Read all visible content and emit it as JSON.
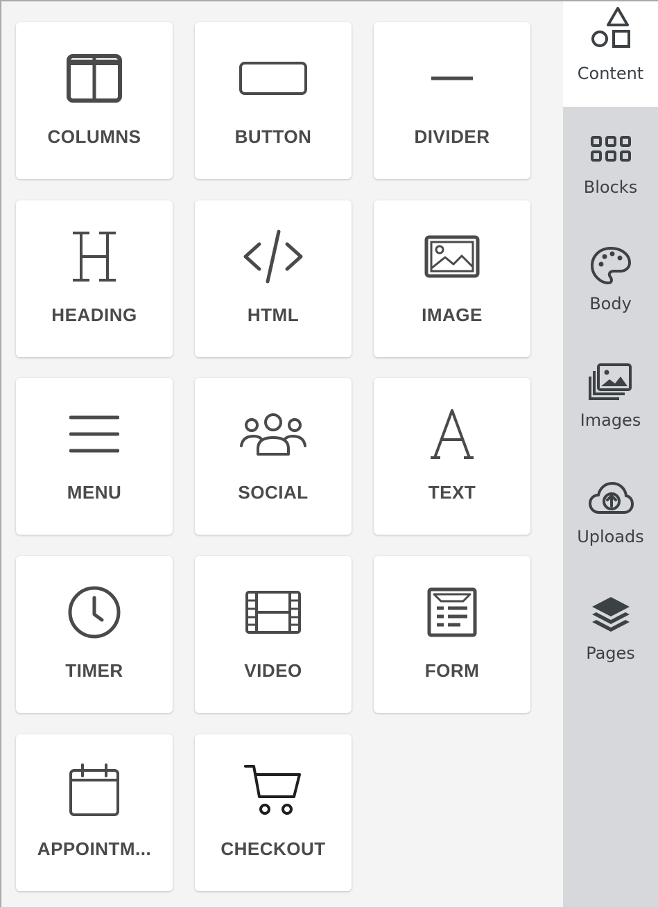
{
  "tools": [
    {
      "label": "COLUMNS",
      "icon": "columns-icon"
    },
    {
      "label": "BUTTON",
      "icon": "button-icon"
    },
    {
      "label": "DIVIDER",
      "icon": "divider-icon"
    },
    {
      "label": "HEADING",
      "icon": "heading-icon"
    },
    {
      "label": "HTML",
      "icon": "code-icon"
    },
    {
      "label": "IMAGE",
      "icon": "image-icon"
    },
    {
      "label": "MENU",
      "icon": "menu-icon"
    },
    {
      "label": "SOCIAL",
      "icon": "social-users-icon"
    },
    {
      "label": "TEXT",
      "icon": "text-icon"
    },
    {
      "label": "TIMER",
      "icon": "clock-icon"
    },
    {
      "label": "VIDEO",
      "icon": "film-icon"
    },
    {
      "label": "FORM",
      "icon": "form-icon"
    },
    {
      "label": "APPOINTM...",
      "icon": "calendar-icon"
    },
    {
      "label": "CHECKOUT",
      "icon": "cart-icon"
    }
  ],
  "sidebar": {
    "active": "Content",
    "items": [
      {
        "label": "Content",
        "icon": "shapes-icon"
      },
      {
        "label": "Blocks",
        "icon": "grid-blocks-icon"
      },
      {
        "label": "Body",
        "icon": "palette-icon"
      },
      {
        "label": "Images",
        "icon": "images-icon"
      },
      {
        "label": "Uploads",
        "icon": "cloud-upload-icon"
      },
      {
        "label": "Pages",
        "icon": "layers-icon"
      }
    ]
  },
  "colors": {
    "icon": "#4a4a4a",
    "panel_bg": "#f4f4f4",
    "sidebar_bg": "#d6d8db",
    "active_tab_bg": "#ffffff"
  }
}
